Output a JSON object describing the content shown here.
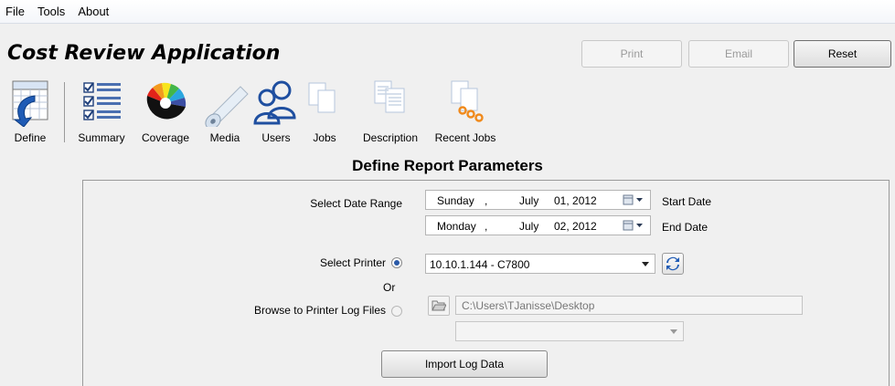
{
  "menu": {
    "file": "File",
    "tools": "Tools",
    "about": "About"
  },
  "app": {
    "title": "Cost Review Application"
  },
  "top_buttons": {
    "print": "Print",
    "email": "Email",
    "reset": "Reset"
  },
  "toolbar": {
    "define": "Define",
    "summary": "Summary",
    "coverage": "Coverage",
    "media": "Media",
    "users": "Users",
    "jobs": "Jobs",
    "description": "Description",
    "recent_jobs": "Recent Jobs"
  },
  "section": {
    "title": "Define Report Parameters"
  },
  "date_range": {
    "label": "Select Date Range",
    "start": {
      "day": "Sunday",
      "sep": ",",
      "month": "July",
      "date": "01, 2012",
      "label": "Start Date"
    },
    "end": {
      "day": "Monday",
      "sep": ",",
      "month": "July",
      "date": "02, 2012",
      "label": "End Date"
    }
  },
  "printer": {
    "label": "Select Printer",
    "selected": true,
    "value": "10.10.1.144  -  C7800"
  },
  "or_text": "Or",
  "browse": {
    "label": "Browse to Printer Log Files",
    "selected": false,
    "path": "C:\\Users\\TJanisse\\Desktop",
    "file_value": ""
  },
  "import_button": "Import Log Data",
  "colors": {
    "accent": "#2a5aa8",
    "panel_border": "#9a9a9a",
    "disabled_text": "#9a9a9a"
  }
}
